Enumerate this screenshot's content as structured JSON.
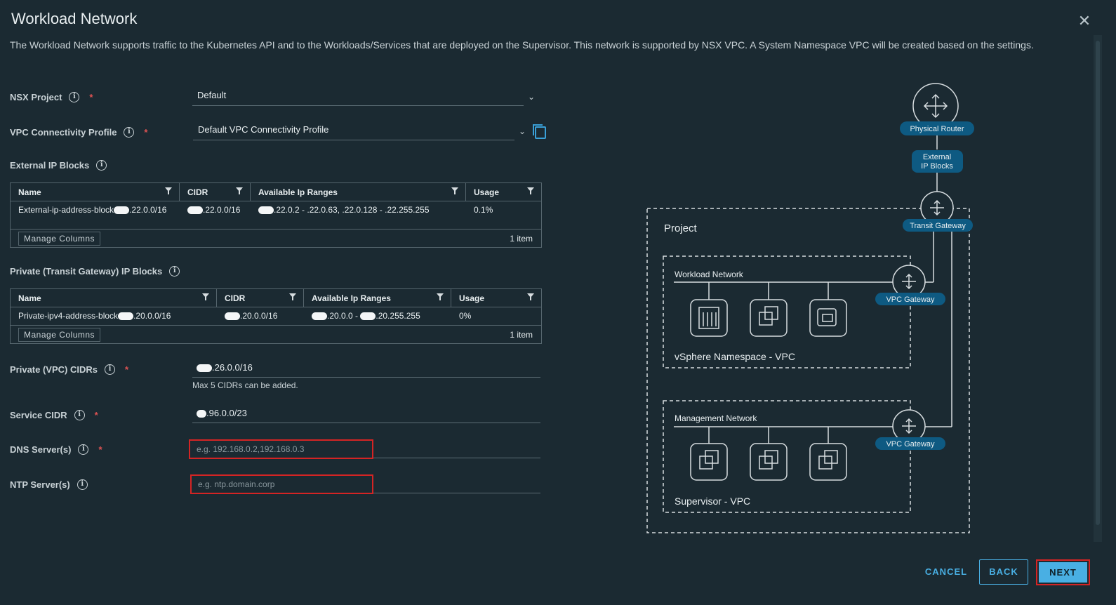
{
  "dialog": {
    "title": "Workload Network",
    "description": "The Workload Network supports traffic to the Kubernetes API and to the Workloads/Services that are deployed on the Supervisor. This network is supported by NSX VPC. A System Namespace VPC will be created based on the settings."
  },
  "nsx_project": {
    "label": "NSX Project",
    "value": "Default"
  },
  "vpc_profile": {
    "label": "VPC Connectivity Profile",
    "value": "Default VPC Connectivity Profile"
  },
  "external_ip_blocks": {
    "label": "External IP Blocks",
    "columns": [
      "Name",
      "CIDR",
      "Available Ip Ranges",
      "Usage"
    ],
    "rows": [
      {
        "name": ".22.0.0/16",
        "name_prefix": "External-ip-address-block",
        "cidr": ".22.0.0/16",
        "ranges": ".22.0.2 - .22.0.63, .22.0.128 - .22.255.255",
        "usage": "0.1%"
      }
    ],
    "manage_columns": "Manage Columns",
    "count": "1 item"
  },
  "private_ip_blocks": {
    "label": "Private (Transit Gateway) IP Blocks",
    "columns": [
      "Name",
      "CIDR",
      "Available Ip Ranges",
      "Usage"
    ],
    "rows": [
      {
        "name_prefix": "Private-ipv4-address-block",
        "name_suffix": ".20.0.0/16",
        "cidr": ".20.0.0/16",
        "ranges_a": ".20.0.0 - ",
        "ranges_b": ".20.255.255",
        "usage": "0%"
      }
    ],
    "manage_columns": "Manage Columns",
    "count": "1 item"
  },
  "private_vpc_cidrs": {
    "label": "Private (VPC) CIDRs",
    "value": ".26.0.0/16",
    "hint": "Max 5 CIDRs can be added."
  },
  "service_cidr": {
    "label": "Service CIDR",
    "value": ".96.0.0/23"
  },
  "dns_servers": {
    "label": "DNS Server(s)",
    "placeholder": "e.g. 192.168.0.2,192.168.0.3"
  },
  "ntp_servers": {
    "label": "NTP Server(s)",
    "placeholder": "e.g. ntp.domain.corp"
  },
  "diagram": {
    "physical_router": "Physical Router",
    "external_ip_blocks_line1": "External",
    "external_ip_blocks_line2": "IP Blocks",
    "transit_gateway": "Transit Gateway",
    "project": "Project",
    "workload_network": "Workload Network",
    "vsphere_namespace_vpc": "vSphere Namespace - VPC",
    "management_network": "Management Network",
    "supervisor_vpc": "Supervisor - VPC",
    "vpc_gateway": "VPC Gateway"
  },
  "footer": {
    "cancel": "CANCEL",
    "back": "BACK",
    "next": "NEXT"
  },
  "colors": {
    "background": "#1b2a32",
    "accent": "#49afe3",
    "highlight": "#d42424",
    "badge": "#0e5a82"
  }
}
